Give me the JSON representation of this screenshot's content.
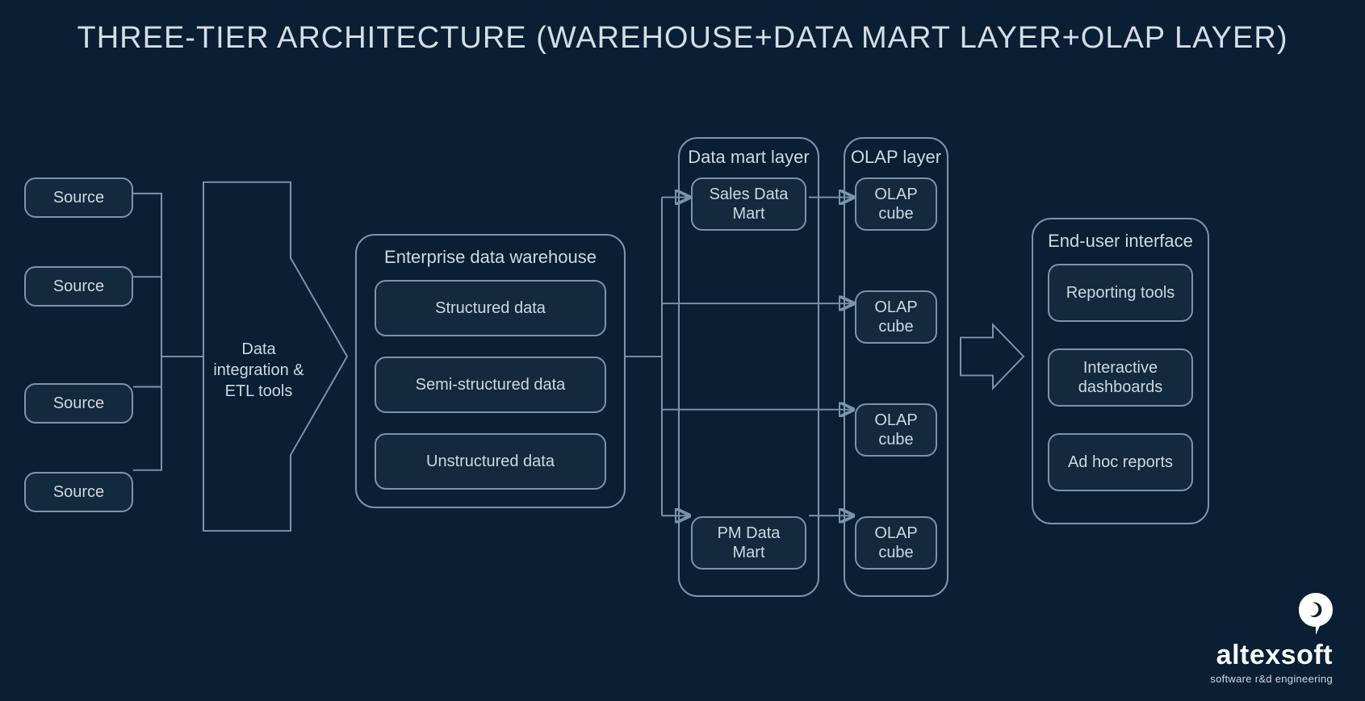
{
  "title": "THREE-TIER ARCHITECTURE (WAREHOUSE+DATA MART LAYER+OLAP LAYER)",
  "sources": [
    "Source",
    "Source",
    "Source",
    "Source"
  ],
  "etl_label": "Data integration & ETL tools",
  "warehouse": {
    "title": "Enterprise data warehouse",
    "items": [
      "Structured data",
      "Semi-structured data",
      "Unstructured data"
    ]
  },
  "data_mart_layer": {
    "title": "Data mart layer",
    "items": [
      "Sales Data Mart",
      "PM Data Mart"
    ]
  },
  "olap_layer": {
    "title": "OLAP layer",
    "items": [
      "OLAP cube",
      "OLAP cube",
      "OLAP cube",
      "OLAP cube"
    ]
  },
  "end_user": {
    "title": "End-user interface",
    "items": [
      "Reporting tools",
      "Interactive dashboards",
      "Ad hoc reports"
    ]
  },
  "logo": {
    "brand": "altexsoft",
    "tagline": "software r&d engineering"
  }
}
